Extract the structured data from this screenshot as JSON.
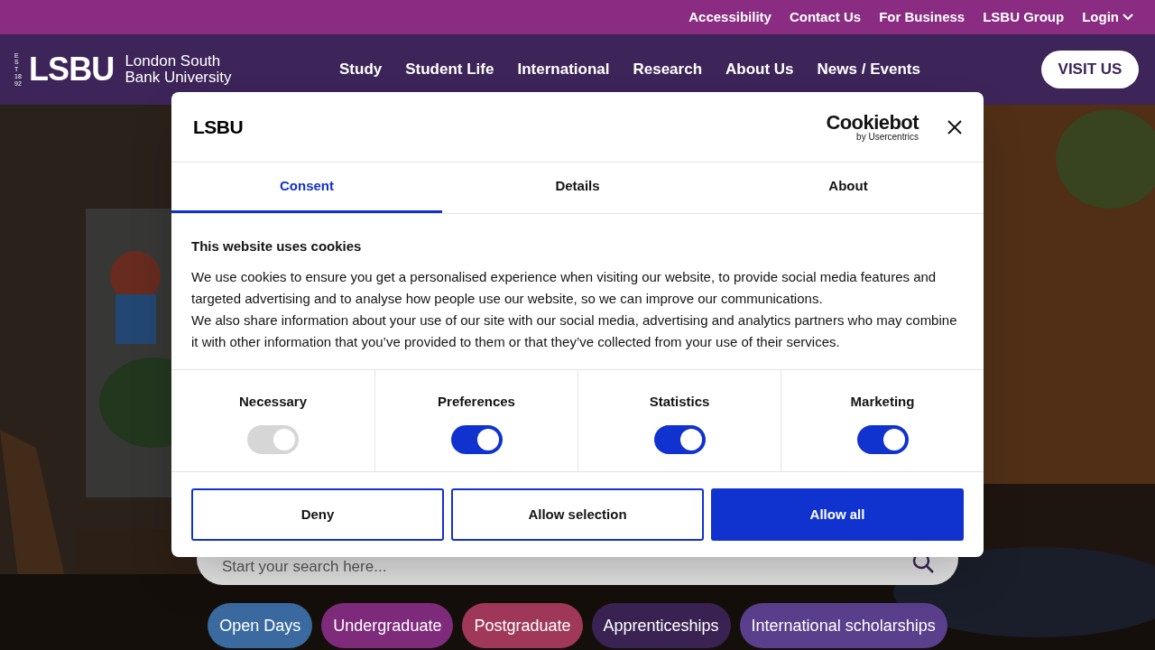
{
  "top_links": [
    "Accessibility",
    "Contact Us",
    "For Business",
    "LSBU Group"
  ],
  "login": {
    "label": "Login"
  },
  "logo": {
    "est": "EST 1892",
    "mark": "LSBU",
    "name_line_1": "London South",
    "name_line_2": "Bank University"
  },
  "nav": [
    "Study",
    "Student Life",
    "International",
    "Research",
    "About Us",
    "News / Events"
  ],
  "visit_button": "VISIT US",
  "hero": {
    "kind": "picture"
  },
  "search": {
    "placeholder": "Start your search here..."
  },
  "quick_links": [
    {
      "label": "Open Days",
      "color": "#3a6aa0"
    },
    {
      "label": "Undergraduate",
      "color": "#7e2b7c"
    },
    {
      "label": "Postgraduate",
      "color": "#a0385a"
    },
    {
      "label": "Apprenticeships",
      "color": "#3a2352"
    },
    {
      "label": "International scholarships",
      "color": "#5a3f8c"
    }
  ],
  "cookie_dialog": {
    "logo": "LSBU",
    "provider": "Cookiebot",
    "provider_sub": "by Usercentrics",
    "tabs": [
      {
        "label": "Consent",
        "selected": true
      },
      {
        "label": "Details",
        "selected": false
      },
      {
        "label": "About",
        "selected": false
      }
    ],
    "heading": "This website uses cookies",
    "paragraphs": [
      "We use cookies to ensure you get a personalised experience when visiting our website, to provide social media features and targeted advertising and to analyse how people use our website, so we can improve our communications.",
      "We also share information about your use of our site with our social media, advertising and analytics partners who may combine it with other information that you’ve provided to them or that they’ve collected from your use of their services."
    ],
    "categories": [
      {
        "label": "Necessary",
        "checked": true,
        "disabled": true
      },
      {
        "label": "Preferences",
        "checked": true,
        "disabled": false
      },
      {
        "label": "Statistics",
        "checked": true,
        "disabled": false
      },
      {
        "label": "Marketing",
        "checked": true,
        "disabled": false
      }
    ],
    "buttons": [
      {
        "label": "Deny",
        "kind": "outline"
      },
      {
        "label": "Allow selection",
        "kind": "outline"
      },
      {
        "label": "Allow all",
        "kind": "primary"
      }
    ]
  }
}
